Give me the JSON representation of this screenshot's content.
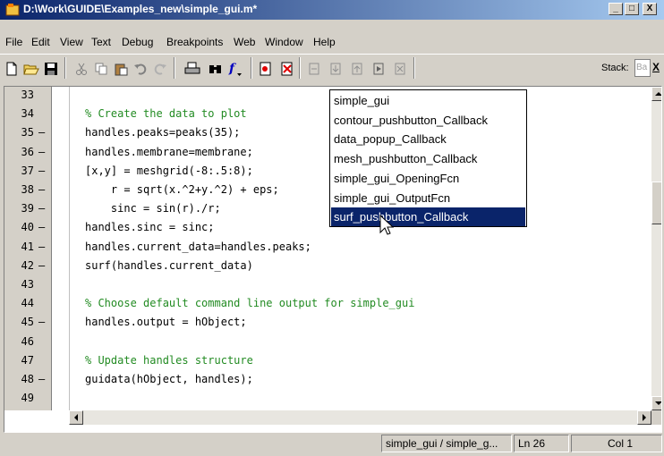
{
  "window": {
    "title": "D:\\Work\\GUIDE\\Examples_new\\simple_gui.m*",
    "minimize": "_",
    "maximize": "□",
    "close": "X"
  },
  "menu": [
    "File",
    "Edit",
    "View",
    "Text",
    "Debug",
    "Breakpoints",
    "Web",
    "Window",
    "Help"
  ],
  "toolbar": {
    "stack_label": "Stack:",
    "stack_value": "Ba",
    "close_label": "X",
    "icons": [
      "new-file-icon",
      "open-folder-icon",
      "save-icon",
      "cut-icon",
      "copy-icon",
      "paste-icon",
      "undo-icon",
      "redo-icon",
      "print-icon",
      "find-icon",
      "function-icon",
      "set-breakpoint-icon",
      "clear-breakpoints-icon",
      "step-icon",
      "step-in-icon",
      "step-out-icon",
      "continue-icon",
      "exit-debug-icon"
    ]
  },
  "editor": {
    "lines": [
      {
        "num": "33",
        "dash": "",
        "code": "",
        "comment": false
      },
      {
        "num": "34",
        "dash": "",
        "code": "% Create the data to plot",
        "comment": true
      },
      {
        "num": "35",
        "dash": "–",
        "code": "handles.peaks=peaks(35);",
        "comment": false
      },
      {
        "num": "36",
        "dash": "–",
        "code": "handles.membrane=membrane;",
        "comment": false
      },
      {
        "num": "37",
        "dash": "–",
        "code": "[x,y] = meshgrid(-8:.5:8);",
        "comment": false
      },
      {
        "num": "38",
        "dash": "–",
        "code": "    r = sqrt(x.^2+y.^2) + eps;",
        "comment": false
      },
      {
        "num": "39",
        "dash": "–",
        "code": "    sinc = sin(r)./r;",
        "comment": false
      },
      {
        "num": "40",
        "dash": "–",
        "code": "handles.sinc = sinc;",
        "comment": false
      },
      {
        "num": "41",
        "dash": "–",
        "code": "handles.current_data=handles.peaks;",
        "comment": false
      },
      {
        "num": "42",
        "dash": "–",
        "code": "surf(handles.current_data)",
        "comment": false
      },
      {
        "num": "43",
        "dash": "",
        "code": "",
        "comment": false
      },
      {
        "num": "44",
        "dash": "",
        "code": "% Choose default command line output for simple_gui",
        "comment": true
      },
      {
        "num": "45",
        "dash": "–",
        "code": "handles.output = hObject;",
        "comment": false
      },
      {
        "num": "46",
        "dash": "",
        "code": "",
        "comment": false
      },
      {
        "num": "47",
        "dash": "",
        "code": "% Update handles structure",
        "comment": true
      },
      {
        "num": "48",
        "dash": "–",
        "code": "guidata(hObject, handles);",
        "comment": false
      },
      {
        "num": "49",
        "dash": "",
        "code": "",
        "comment": false
      }
    ]
  },
  "function_dropdown": {
    "items": [
      "simple_gui",
      "contour_pushbutton_Callback",
      "data_popup_Callback",
      "mesh_pushbutton_Callback",
      "simple_gui_OpeningFcn",
      "simple_gui_OutputFcn",
      "surf_pushbutton_Callback"
    ],
    "selected_index": 6
  },
  "status": {
    "function": "simple_gui / simple_g...",
    "line": "Ln 26",
    "column": "Col 1"
  },
  "colors": {
    "titlebar_start": "#0a246a",
    "titlebar_end": "#a6caf0",
    "comment": "#228b22",
    "selection": "#0a246a"
  }
}
